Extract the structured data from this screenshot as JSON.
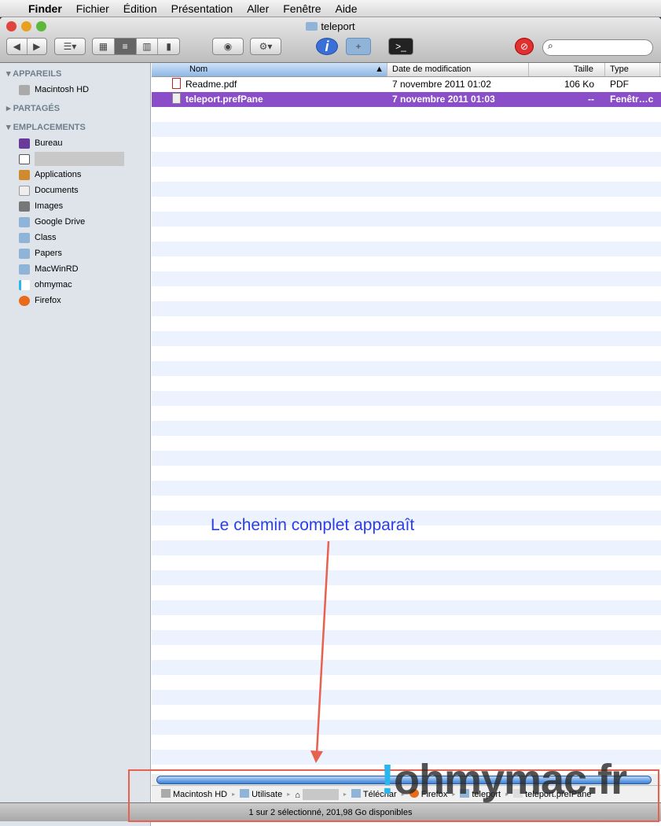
{
  "menubar": {
    "items": [
      "Finder",
      "Fichier",
      "Édition",
      "Présentation",
      "Aller",
      "Fenêtre",
      "Aide"
    ]
  },
  "window": {
    "title": "teleport"
  },
  "sidebar": {
    "sections": [
      {
        "label": "APPAREILS",
        "items": [
          "Macintosh HD"
        ]
      },
      {
        "label": "PARTAGÉS",
        "items": []
      },
      {
        "label": "EMPLACEMENTS",
        "items": [
          "Bureau",
          "",
          "Applications",
          "Documents",
          "Images",
          "Google Drive",
          "Class",
          "Papers",
          "MacWinRD",
          "ohmymac",
          "Firefox"
        ]
      }
    ]
  },
  "columns": [
    "Nom",
    "Date de modification",
    "Taille",
    "Type"
  ],
  "files": [
    {
      "name": "Readme.pdf",
      "date": "7 novembre 2011 01:02",
      "size": "106 Ko",
      "type": "PDF",
      "selected": false
    },
    {
      "name": "teleport.prefPane",
      "date": "7 novembre 2011 01:03",
      "size": "--",
      "type": "Fenêtr…c",
      "selected": true
    }
  ],
  "pathbar": [
    "Macintosh HD",
    "Utilisate",
    "",
    "Téléchar",
    "Firefox",
    "teleport",
    "teleport.prefPane"
  ],
  "status": "1 sur 2 sélectionné, 201,98 Go disponibles",
  "annotation": "Le chemin complet apparaît",
  "watermark": "!ohmymac.fr",
  "colors": {
    "selection": "#8a4fc8",
    "annotation": "#2a3ee8",
    "arrow": "#e8604e"
  }
}
